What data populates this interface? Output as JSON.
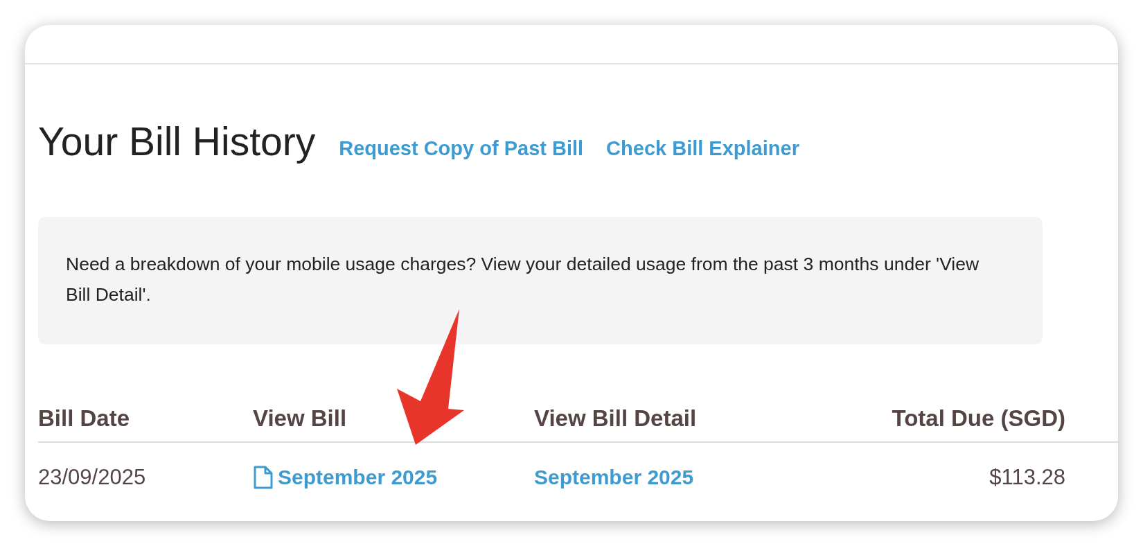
{
  "heading": "Your Bill History",
  "links": [
    "Request Copy of Past Bill",
    "Check Bill Explainer"
  ],
  "notice": "Need a breakdown of your mobile usage charges? View your detailed usage from the past 3 months under 'View Bill Detail'.",
  "table": {
    "columns": [
      "Bill Date",
      "View Bill",
      "View Bill Detail",
      "Total Due (SGD)"
    ],
    "rows": [
      {
        "bill_date": "23/09/2025",
        "view_bill": "September 2025",
        "view_bill_detail": "September 2025",
        "total_due": "$113.28"
      }
    ]
  }
}
